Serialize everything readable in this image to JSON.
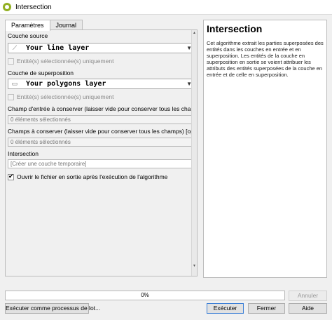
{
  "window": {
    "title": "Intersection",
    "icon": "qgis-logo-icon"
  },
  "tabs": [
    {
      "label": "Paramètres",
      "active": true
    },
    {
      "label": "Journal",
      "active": false
    }
  ],
  "params": {
    "input_layer_label": "Couche source",
    "input_layer_value": "Your line layer",
    "input_selected_only": "Entité(s) sélectionnée(s) uniquement",
    "overlay_layer_label": "Couche de superposition",
    "overlay_layer_value": "Your polygons layer",
    "overlay_selected_only": "Entité(s) sélectionnée(s) uniquement",
    "input_fields_label": "Champ d'entrée à conserver (laisser vide pour conserver tous les champs) [option",
    "input_fields_value": "0 éléments sélectionnés",
    "overlay_fields_label": "Champs à conserver (laisser vide pour conserver tous les champs) [optional]",
    "overlay_fields_value": "0 éléments sélectionnés",
    "output_label": "Intersection",
    "output_placeholder": "[Créer une couche temporaire]",
    "open_output_label": "Ouvrir le fichier en sortie après l'exécution de l'algorithme",
    "open_output_checked": true
  },
  "help": {
    "title": "Intersection",
    "text": "Cet algorithme extrait les parties superposées des entités dans les couches en entrée et en superposition. Les entités de la couche en superposition en sortie se voient attribuer les attributs des entités superposées de la couche en entrée et de celle en superposition."
  },
  "progress": {
    "text": "0%",
    "value": 0
  },
  "buttons": {
    "cancel": "Annuler",
    "batch": "Exécuter comme processus de lot...",
    "run": "Exécuter",
    "close": "Fermer",
    "help": "Aide"
  }
}
